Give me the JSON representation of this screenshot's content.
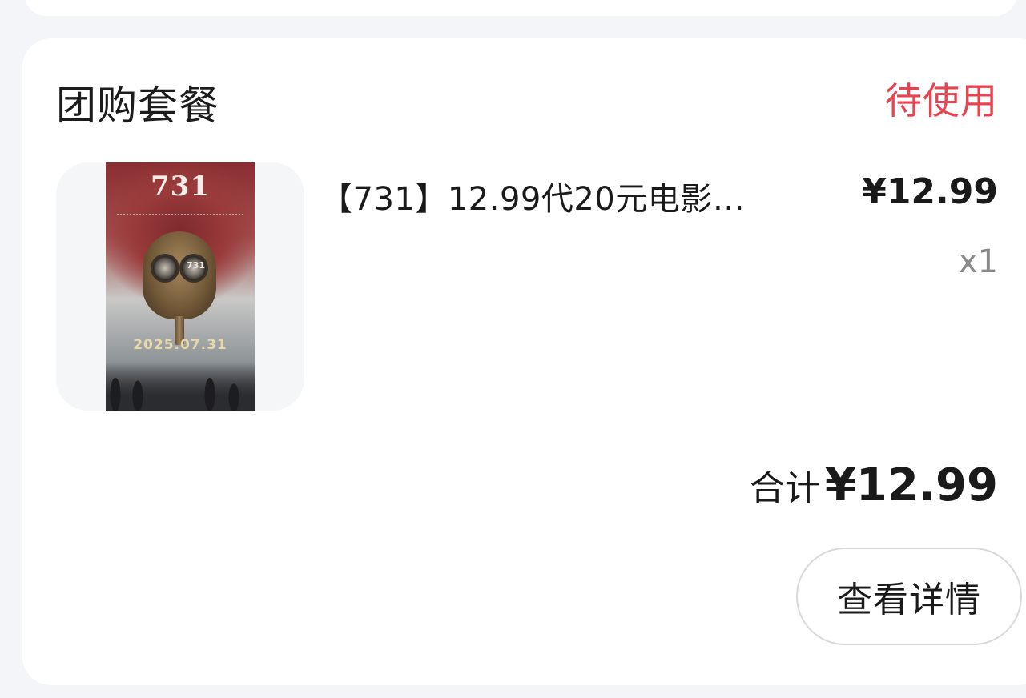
{
  "card": {
    "title": "团购套餐",
    "status": "待使用",
    "status_color": "#e8434f"
  },
  "product": {
    "poster": {
      "title": "731",
      "date": "2025.07.31",
      "lens_text": "731"
    },
    "name": "【731】12.99代20元电影…",
    "unit_price": "¥12.99",
    "quantity": "x1"
  },
  "summary": {
    "total_label": "合计",
    "total_value": "¥12.99"
  },
  "actions": {
    "detail_label": "查看详情"
  }
}
